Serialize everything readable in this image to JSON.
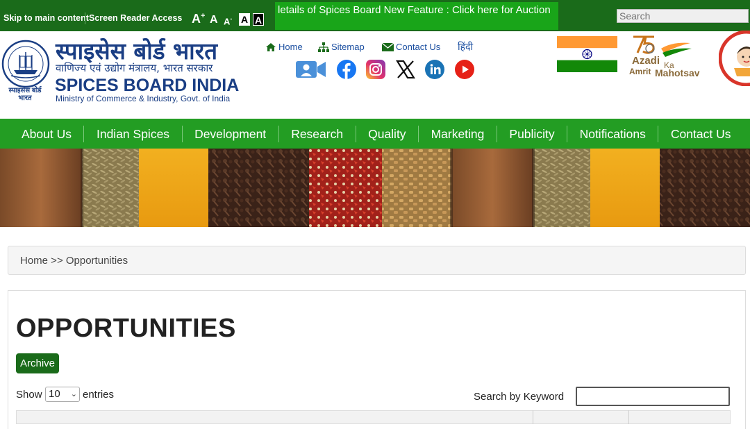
{
  "topbar": {
    "skip_link": "Skip to main content",
    "screen_reader": "Screen Reader Access",
    "font_increase": "A",
    "font_increase_sup": "+",
    "font_normal": "A",
    "font_decrease": "A",
    "font_decrease_sup": "-",
    "contrast_light": "A",
    "contrast_dark": "A",
    "ticker_text": "letails of Spices Board New Feature : Click here for Auction",
    "search_placeholder": "Search"
  },
  "header": {
    "brand_hindi": "स्पाइसेस बोर्ड भारत",
    "brand_hindi_sub": "वाणिज्य एवं उद्योग मंत्रालय, भारत सरकार",
    "brand_english": "SPICES BOARD INDIA",
    "ministry": "Ministry of Commerce & Industry, Govt. of India",
    "emblem_caption_1": "स्पाइसेस बोर्ड",
    "emblem_caption_2": "भारत",
    "quick_links": {
      "home": "Home",
      "sitemap": "Sitemap",
      "contact": "Contact Us",
      "hindi": "हिंदी"
    },
    "azadi_line1": "Azadi",
    "azadi_ka": "Ka",
    "azadi_amrit": "Amrit",
    "azadi_mahotsav": "Mahotsav"
  },
  "nav": {
    "items": [
      "About Us",
      "Indian Spices",
      "Development",
      "Research",
      "Quality",
      "Marketing",
      "Publicity",
      "Notifications",
      "Contact Us"
    ]
  },
  "breadcrumb": {
    "text": "Home >> Opportunities"
  },
  "main": {
    "title": "OPPORTUNITIES",
    "archive_label": "Archive",
    "show_label": "Show",
    "page_size": "10",
    "entries_label": "entries",
    "search_label": "Search by Keyword"
  },
  "colors": {
    "topbar": "#1a6b1a",
    "ticker": "#19a519",
    "nav": "#239d23",
    "brand_blue": "#1a3e84"
  }
}
